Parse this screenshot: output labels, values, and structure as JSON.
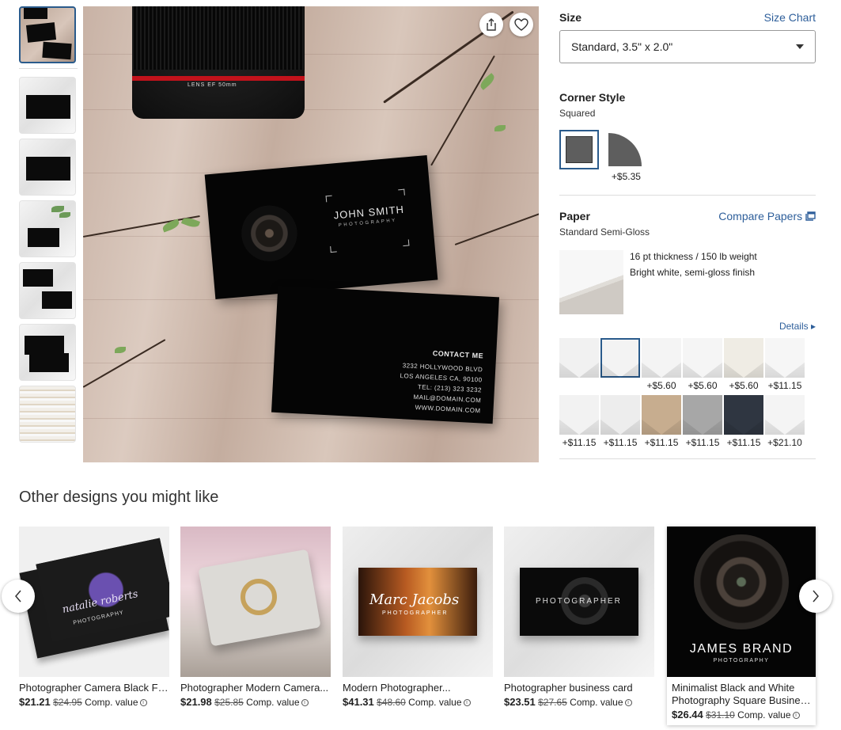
{
  "gallery": {
    "thumbnails": [
      "thumb-1",
      "thumb-2",
      "thumb-3",
      "thumb-4",
      "thumb-5",
      "thumb-6",
      "thumb-7"
    ],
    "hero_card": {
      "name": "JOHN SMITH",
      "subtitle": "PHOTOGRAPHY",
      "lens_text": "LENS   EF   50mm",
      "contact_title": "CONTACT ME",
      "contact_lines": [
        "3232 HOLLYWOOD BLVD",
        "LOS ANGELES CA, 90100",
        "TEL: (213) 323 3232",
        "MAIL@DOMAIN.COM",
        "WWW.DOMAIN.COM"
      ]
    }
  },
  "size": {
    "label": "Size",
    "chart_link": "Size Chart",
    "selected": "Standard, 3.5\" x 2.0\""
  },
  "corner": {
    "label": "Corner Style",
    "selected": "Squared",
    "options": [
      {
        "name": "Squared",
        "price": ""
      },
      {
        "name": "Rounded",
        "price": "+$5.35"
      }
    ]
  },
  "paper": {
    "label": "Paper",
    "compare_link": "Compare Papers",
    "selected": "Standard Semi-Gloss",
    "desc_1": "16 pt thickness / 150 lb weight",
    "desc_2": "Bright white, semi-gloss finish",
    "details_link": "Details",
    "swatches": [
      {
        "color": "#f1f1f1",
        "price": ""
      },
      {
        "color": "#f3f3f3",
        "price": ""
      },
      {
        "color": "#f4f4f4",
        "price": "+$5.60"
      },
      {
        "color": "#f5f5f5",
        "price": "+$5.60"
      },
      {
        "color": "#efece4",
        "price": "+$5.60"
      },
      {
        "color": "#f6f6f6",
        "price": "+$11.15"
      },
      {
        "color": "#f2f2f2",
        "price": "+$11.15"
      },
      {
        "color": "#ededed",
        "price": "+$11.15"
      },
      {
        "color": "#c7ad8f",
        "price": "+$11.15"
      },
      {
        "color": "#a7a7a7",
        "price": "+$11.15"
      },
      {
        "color": "#2f3641",
        "price": "+$11.15"
      },
      {
        "color": "#f4f4f4",
        "price": "+$21.10"
      }
    ]
  },
  "recommendations": {
    "title": "Other designs you might like",
    "comp_label": "Comp. value",
    "items": [
      {
        "title": "Photographer Camera Black Floral...",
        "price": "$21.21",
        "old": "$24.95",
        "card_text": "natalie roberts",
        "card_sub": "PHOTOGRAPHY"
      },
      {
        "title": "Photographer Modern Camera...",
        "price": "$21.98",
        "old": "$25.85",
        "card_text": "",
        "card_sub": ""
      },
      {
        "title": "Modern Photographer...",
        "price": "$41.31",
        "old": "$48.60",
        "card_text": "Marc Jacobs",
        "card_sub": "PHOTOGRAPHER"
      },
      {
        "title": "Photographer business card",
        "price": "$23.51",
        "old": "$27.65",
        "card_text": "PHOTOGRAPHER",
        "card_sub": ""
      },
      {
        "title_1": "Minimalist Black and White",
        "title_2": "Photography Square Business...",
        "price": "$26.44",
        "old": "$31.10",
        "card_text": "JAMES BRAND",
        "card_sub": "PHOTOGRAPHY"
      }
    ]
  }
}
